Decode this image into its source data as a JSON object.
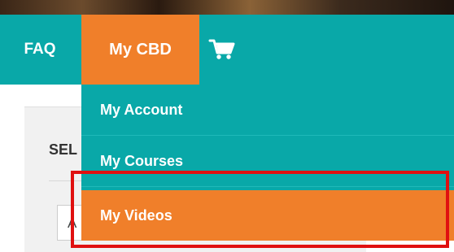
{
  "nav": {
    "items": [
      {
        "label": "FAQ"
      },
      {
        "label": "My CBD"
      }
    ],
    "cart_icon": "shopping-cart-icon"
  },
  "dropdown": {
    "items": [
      {
        "label": "My Account"
      },
      {
        "label": "My Courses"
      },
      {
        "label": "My Videos"
      }
    ],
    "active_index": 2
  },
  "card": {
    "select_label": "SEL",
    "input_value": "A"
  },
  "colors": {
    "nav_bg": "#09a8a8",
    "accent": "#f07f2a",
    "highlight": "#e01010",
    "text_on_dark": "#ffffff"
  }
}
